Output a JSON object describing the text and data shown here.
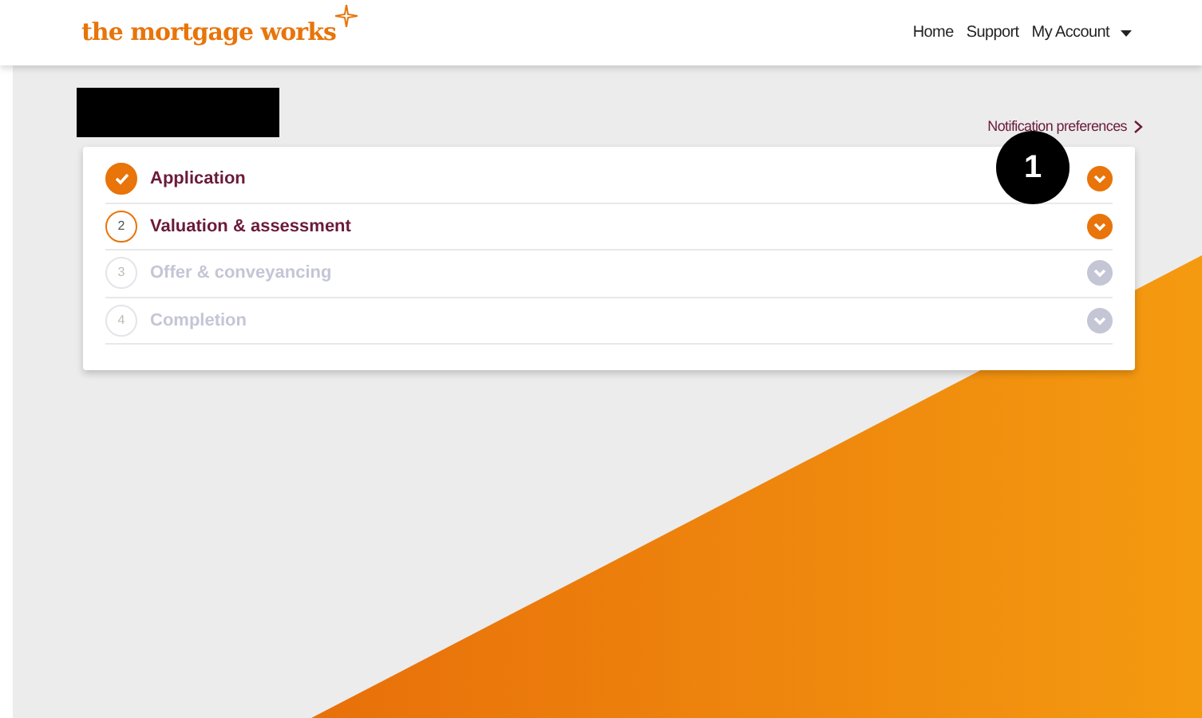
{
  "header": {
    "logo": "the mortgage works",
    "nav": [
      "Home",
      "Support",
      "My Account"
    ]
  },
  "notification_link": "Notification preferences",
  "marker": "1",
  "steps": [
    {
      "label": "Application",
      "kind": "complete"
    },
    {
      "number": "2",
      "label": "Valuation & assessment",
      "kind": "current"
    },
    {
      "number": "3",
      "label": "Offer & conveyancing",
      "kind": "pending"
    },
    {
      "number": "4",
      "label": "Completion",
      "kind": "pending"
    }
  ]
}
